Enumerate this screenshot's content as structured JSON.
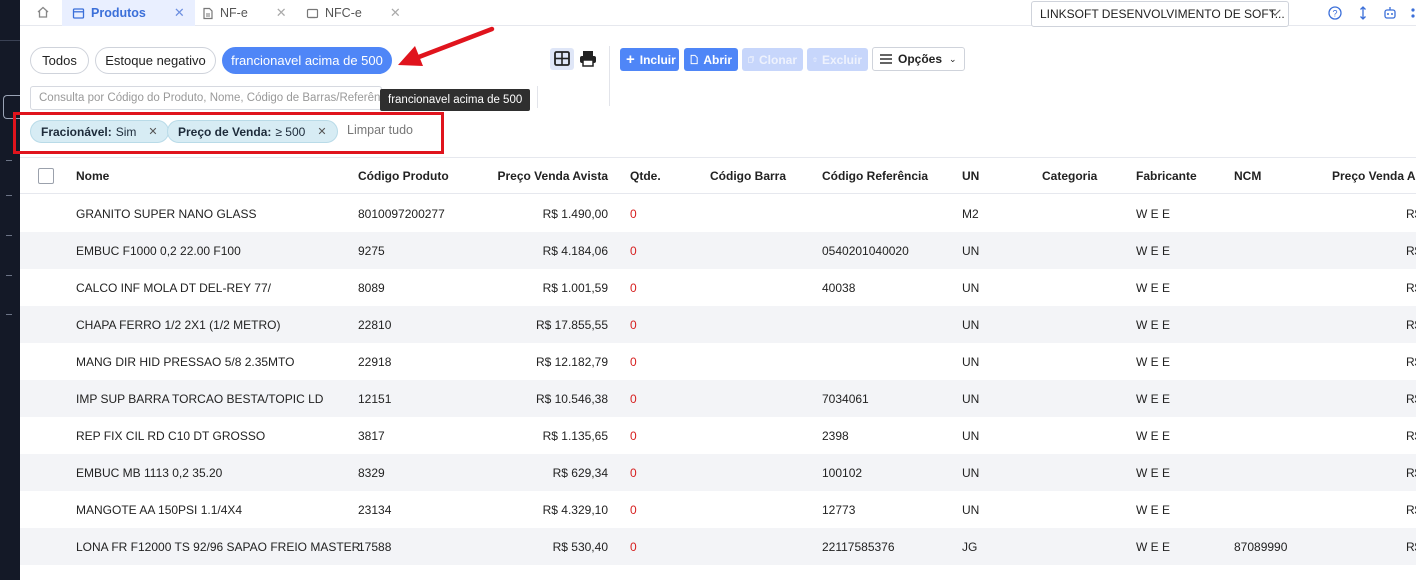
{
  "tabs": [
    {
      "label": "Produtos",
      "active": true
    },
    {
      "label": "NF-e",
      "active": false
    },
    {
      "label": "NFC-e",
      "active": false
    }
  ],
  "company_select": {
    "value": "LINKSOFT DESENVOLVIMENTO DE SOFT..."
  },
  "filter_pills": [
    "Todos",
    "Estoque negativo",
    "francionavel acima de 500"
  ],
  "toolbar": {
    "incluir": "Incluir",
    "abrir": "Abrir",
    "clonar": "Clonar",
    "excluir": "Excluir",
    "opcoes": "Opções"
  },
  "search": {
    "placeholder": "Consulta por Código do Produto, Nome, Código de Barras/Referência"
  },
  "tooltip": "francionavel acima de 500",
  "chips": [
    {
      "key": "Fracionável:",
      "value": "Sim"
    },
    {
      "key": "Preço de Venda:",
      "value": "≥ 500"
    }
  ],
  "clear_all": "Limpar tudo",
  "table": {
    "headers": [
      "Nome",
      "Código Produto",
      "Preço Venda Avista",
      "Qtde.",
      "Código Barra",
      "Código Referência",
      "UN",
      "Categoria",
      "Fabricante",
      "NCM",
      "Preço Venda A p"
    ],
    "rows": [
      {
        "nome": "GRANITO SUPER NANO GLASS",
        "codigo": "8010097200277",
        "preco": "R$ 1.490,00",
        "qtde": "0",
        "barra": "",
        "ref": "",
        "un": "M2",
        "cat": "",
        "fab": "W E E",
        "ncm": "",
        "prazo": "R$"
      },
      {
        "nome": "EMBUC F1000 0,2 22.00 F100",
        "codigo": "9275",
        "preco": "R$ 4.184,06",
        "qtde": "0",
        "barra": "",
        "ref": "0540201040020",
        "un": "UN",
        "cat": "",
        "fab": "W E E",
        "ncm": "",
        "prazo": "R$"
      },
      {
        "nome": "CALCO INF MOLA DT DEL-REY 77/",
        "codigo": "8089",
        "preco": "R$ 1.001,59",
        "qtde": "0",
        "barra": "",
        "ref": "40038",
        "un": "UN",
        "cat": "",
        "fab": "W E E",
        "ncm": "",
        "prazo": "R$"
      },
      {
        "nome": "CHAPA FERRO 1/2 2X1 (1/2 METRO)",
        "codigo": "22810",
        "preco": "R$ 17.855,55",
        "qtde": "0",
        "barra": "",
        "ref": "",
        "un": "UN",
        "cat": "",
        "fab": "W E E",
        "ncm": "",
        "prazo": "R$"
      },
      {
        "nome": "MANG DIR HID PRESSAO 5/8 2.35MTO",
        "codigo": "22918",
        "preco": "R$ 12.182,79",
        "qtde": "0",
        "barra": "",
        "ref": "",
        "un": "UN",
        "cat": "",
        "fab": "W E E",
        "ncm": "",
        "prazo": "R$"
      },
      {
        "nome": "IMP SUP BARRA TORCAO BESTA/TOPIC LD",
        "codigo": "12151",
        "preco": "R$ 10.546,38",
        "qtde": "0",
        "barra": "",
        "ref": "7034061",
        "un": "UN",
        "cat": "",
        "fab": "W E E",
        "ncm": "",
        "prazo": "R$"
      },
      {
        "nome": "REP FIX CIL RD C10 DT GROSSO",
        "codigo": "3817",
        "preco": "R$ 1.135,65",
        "qtde": "0",
        "barra": "",
        "ref": "2398",
        "un": "UN",
        "cat": "",
        "fab": "W E E",
        "ncm": "",
        "prazo": "R$"
      },
      {
        "nome": "EMBUC MB 1113 0,2 35.20",
        "codigo": "8329",
        "preco": "R$ 629,34",
        "qtde": "0",
        "barra": "",
        "ref": "100102",
        "un": "UN",
        "cat": "",
        "fab": "W E E",
        "ncm": "",
        "prazo": "R$"
      },
      {
        "nome": "MANGOTE AA 150PSI 1.1/4X4",
        "codigo": "23134",
        "preco": "R$ 4.329,10",
        "qtde": "0",
        "barra": "",
        "ref": "12773",
        "un": "UN",
        "cat": "",
        "fab": "W E E",
        "ncm": "",
        "prazo": "R$"
      },
      {
        "nome": "LONA FR F12000 TS 92/96 SAPAO FREIO MASTER",
        "codigo": "17588",
        "preco": "R$ 530,40",
        "qtde": "0",
        "barra": "",
        "ref": "22117585376",
        "un": "JG",
        "cat": "",
        "fab": "W E E",
        "ncm": "87089990",
        "prazo": "R$"
      }
    ]
  },
  "colors": {
    "accent": "#4f86f7",
    "highlight_red": "#e0141d",
    "chip_bg": "#d7ecf4",
    "rail": "#141927"
  }
}
